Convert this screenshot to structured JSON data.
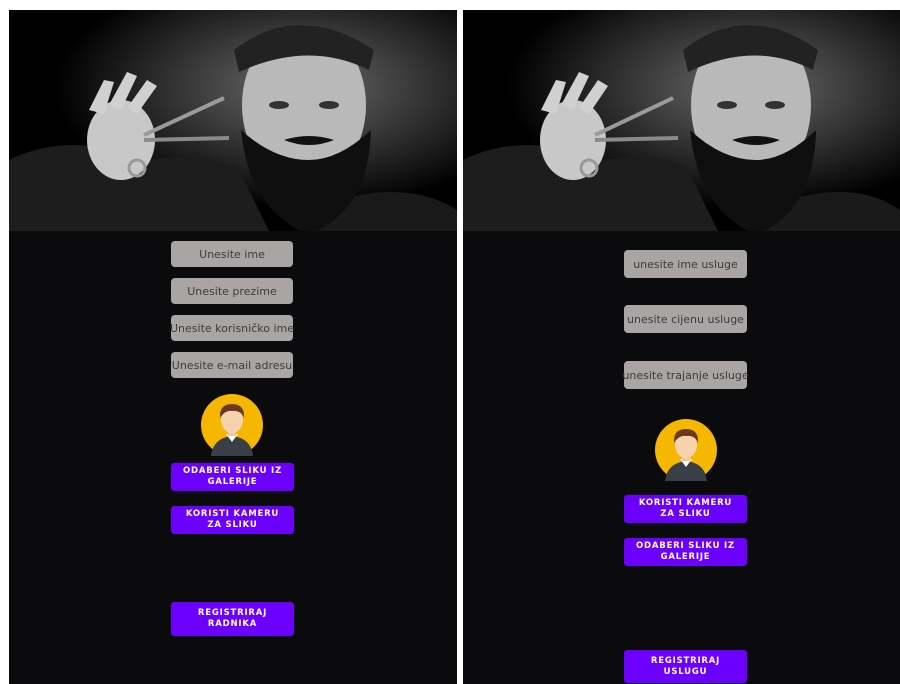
{
  "left_screen": {
    "fields": {
      "first_name_placeholder": "Unesite ime",
      "last_name_placeholder": "Unesite prezime",
      "username_placeholder": "Unesite korisničko ime",
      "email_placeholder": "Unesite e-mail adresu"
    },
    "buttons": {
      "gallery": "ODABERI SLIKU IZ GALERIJE",
      "camera": "KORISTI KAMERU ZA SLIKU",
      "register": "REGISTRIRAJ RADNIKA"
    }
  },
  "right_screen": {
    "fields": {
      "service_name_placeholder": "unesite ime usluge",
      "service_price_placeholder": "unesite cijenu usluge",
      "service_duration_placeholder": "unesite trajanje usluge"
    },
    "buttons": {
      "camera": "KORISTI KAMERU ZA SLIKU",
      "gallery": "ODABERI SLIKU IZ GALERIJE",
      "register": "REGISTRIRAJ USLUGU"
    }
  },
  "colors": {
    "background": "#0b0b0d",
    "field": "#a9a5a5",
    "button": "#6c00ff",
    "avatar_circle": "#f5b700"
  },
  "icons": {
    "hero": "barber-photo",
    "avatar": "avatar-icon"
  }
}
